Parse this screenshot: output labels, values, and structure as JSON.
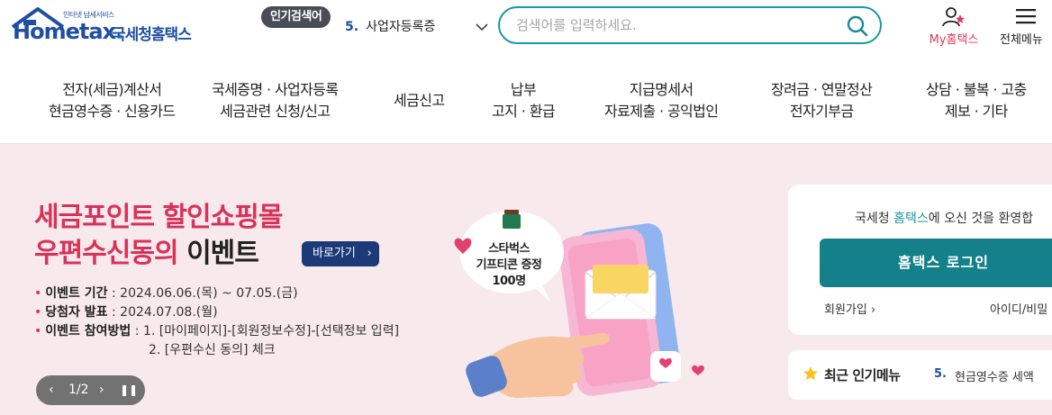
{
  "header": {
    "logo": {
      "small_text": "인터넷 납세서비스",
      "brand": "Hometax",
      "brand_kr": "국세청홈택스"
    },
    "popular_search": {
      "badge": "인기검색어",
      "rank": "5.",
      "keyword": "사업자등록증"
    },
    "search": {
      "placeholder": "검색어를 입력하세요."
    },
    "my_hometax_label": "My홈택스",
    "all_menu_label": "전체메뉴"
  },
  "nav": {
    "items": [
      {
        "line1": "전자(세금)계산서",
        "line2": "현금영수증 · 신용카드"
      },
      {
        "line1": "국세증명 · 사업자등록",
        "line2": "세금관련 신청/신고"
      },
      {
        "line1": "세금신고",
        "line2": ""
      },
      {
        "line1": "납부",
        "line2": "고지 · 환급"
      },
      {
        "line1": "지급명세서",
        "line2": "자료제출 · 공익법인"
      },
      {
        "line1": "장려금 · 연말정산",
        "line2": "전자기부금"
      },
      {
        "line1": "상담 · 불복 · 고충",
        "line2": "제보 · 기타"
      }
    ]
  },
  "event": {
    "title_line1": "세금포인트 할인쇼핑몰",
    "title_line2_pink": "우편수신동의",
    "title_line2_dark": "이벤트",
    "go_button": "바로가기",
    "rows": [
      {
        "key": "이벤트 기간",
        "value": "2024.06.06.(목) ~ 07.05.(금)"
      },
      {
        "key": "당첨자 발표",
        "value": "2024.07.08.(월)"
      },
      {
        "key": "이벤트 참여방법",
        "value": "1. [마이페이지]-[회원정보수정]-[선택정보 입력]"
      }
    ],
    "row_cont": "2. [우편수신 동의] 체크",
    "bubble": {
      "line1": "스타벅스",
      "line2": "기프티콘 증정",
      "line3": "100명"
    },
    "pager": {
      "count": "1/2"
    }
  },
  "login": {
    "welcome_prefix": "국세청 ",
    "welcome_highlight": "홈택스",
    "welcome_suffix": "에 오신 것을 환영합",
    "login_button": "홈택스 로그인",
    "join": "회원가입",
    "find_id": "아이디/비밀"
  },
  "recent": {
    "title": "최근 인기메뉴",
    "rank": "5.",
    "item": "현금영수증 세액"
  },
  "colors": {
    "brand_blue": "#1f4ea3",
    "teal": "#14808a",
    "pink": "#d8325a",
    "banner_bg": "#f8e9ec"
  }
}
